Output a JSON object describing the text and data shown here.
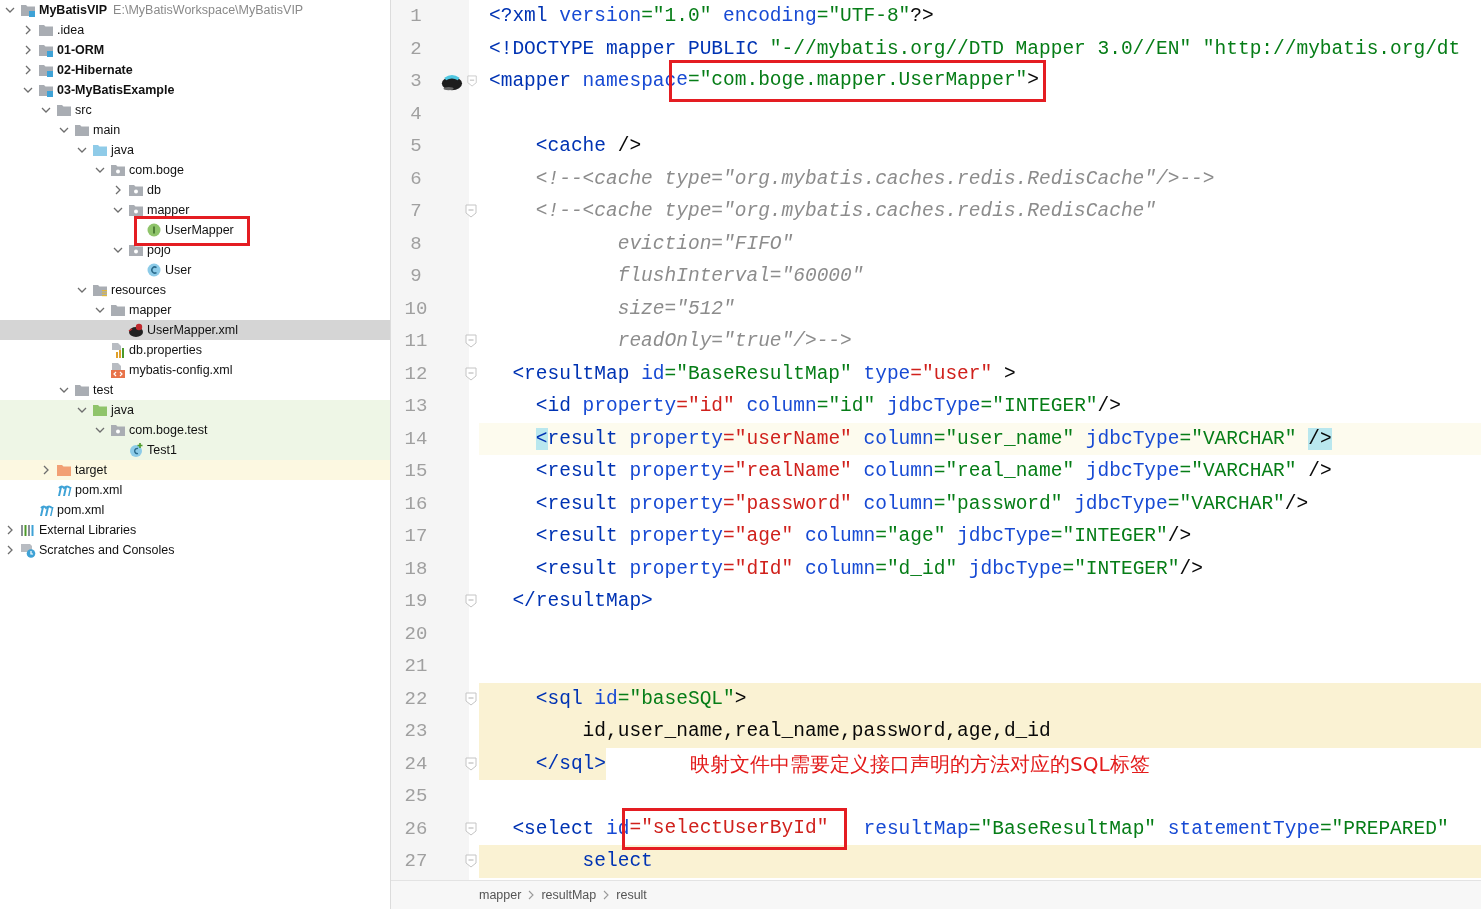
{
  "tree": [
    {
      "label": "MyBatisVIP",
      "path": "E:\\MyBatisWorkspace\\MyBatisVIP",
      "kind": "module",
      "bold": true,
      "expanded": true,
      "selected": false,
      "children": [
        {
          "label": ".idea",
          "kind": "folder",
          "expanded": false,
          "selected": false
        },
        {
          "label": "01-ORM",
          "kind": "module",
          "bold": true,
          "expanded": false,
          "selected": false
        },
        {
          "label": "02-Hibernate",
          "kind": "module",
          "bold": true,
          "expanded": false,
          "selected": false
        },
        {
          "label": "03-MyBatisExample",
          "kind": "module",
          "bold": true,
          "expanded": true,
          "selected": false,
          "children": [
            {
              "label": "src",
              "kind": "folder",
              "expanded": true,
              "selected": false,
              "children": [
                {
                  "label": "main",
                  "kind": "folder",
                  "expanded": true,
                  "selected": false,
                  "children": [
                    {
                      "label": "java",
                      "kind": "source",
                      "expanded": true,
                      "selected": false,
                      "children": [
                        {
                          "label": "com.boge",
                          "kind": "package",
                          "expanded": true,
                          "selected": false,
                          "children": [
                            {
                              "label": "db",
                              "kind": "package",
                              "expanded": false,
                              "selected": false
                            },
                            {
                              "label": "mapper",
                              "kind": "package",
                              "expanded": true,
                              "selected": false,
                              "children": [
                                {
                                  "label": "UserMapper",
                                  "kind": "interface",
                                  "selected": false,
                                  "boxed": true
                                }
                              ]
                            },
                            {
                              "label": "pojo",
                              "kind": "package",
                              "expanded": true,
                              "selected": false,
                              "children": [
                                {
                                  "label": "User",
                                  "kind": "class",
                                  "selected": false
                                }
                              ]
                            }
                          ]
                        }
                      ]
                    },
                    {
                      "label": "resources",
                      "kind": "resources",
                      "expanded": true,
                      "selected": false,
                      "children": [
                        {
                          "label": "mapper",
                          "kind": "folder",
                          "expanded": true,
                          "selected": false,
                          "children": [
                            {
                              "label": "UserMapper.xml",
                              "kind": "mybatis",
                              "selected": true
                            }
                          ]
                        },
                        {
                          "label": "db.properties",
                          "kind": "properties",
                          "selected": false
                        },
                        {
                          "label": "mybatis-config.xml",
                          "kind": "xml",
                          "selected": false
                        }
                      ]
                    }
                  ]
                },
                {
                  "label": "test",
                  "kind": "folder",
                  "expanded": true,
                  "selected": false,
                  "children": [
                    {
                      "label": "java",
                      "kind": "test",
                      "test_scope": true,
                      "expanded": true,
                      "selected": false,
                      "children": [
                        {
                          "label": "com.boge.test",
                          "kind": "package",
                          "test_scope": true,
                          "expanded": true,
                          "selected": false,
                          "children": [
                            {
                              "label": "Test1",
                              "kind": "testclass",
                              "test_scope": true,
                              "selected": false
                            }
                          ]
                        }
                      ]
                    }
                  ]
                }
              ]
            },
            {
              "label": "target",
              "kind": "excluded",
              "excluded": true,
              "expanded": false,
              "selected": false
            },
            {
              "label": "pom.xml",
              "kind": "maven",
              "selected": false
            }
          ]
        },
        {
          "label": "pom.xml",
          "kind": "maven",
          "selected": false
        }
      ]
    },
    {
      "label": "External Libraries",
      "kind": "libraries",
      "expanded": false,
      "selected": false
    },
    {
      "label": "Scratches and Consoles",
      "kind": "scratches",
      "expanded": false,
      "selected": false
    }
  ],
  "editor": {
    "lines": [
      {
        "number": "1",
        "tokens": [
          {
            "kind": "tag",
            "text": "<?xml"
          },
          {
            "kind": "attr",
            "text": " version"
          },
          {
            "kind": "str",
            "text": "=\"1.0\""
          },
          {
            "kind": "attr",
            "text": " encoding"
          },
          {
            "kind": "str",
            "text": "=\"UTF-8\""
          },
          {
            "kind": "plain",
            "text": "?>"
          }
        ]
      },
      {
        "number": "2",
        "tokens": [
          {
            "kind": "tag",
            "text": "<!DOCTYPE mapper PUBLIC"
          },
          {
            "kind": "str",
            "text": " \"-//mybatis.org//DTD Mapper 3.0//EN\" \"http://mybatis.org/dt"
          }
        ]
      },
      {
        "number": "3",
        "gutter_icon": true,
        "fold": true,
        "tokens": [
          {
            "kind": "tag",
            "text": "<mapper"
          },
          {
            "kind": "attr",
            "text": " namespac"
          },
          {
            "kind": "box",
            "tokens": [
              {
                "kind": "attr",
                "text": "e"
              },
              {
                "kind": "str",
                "text": "=\"com.boge.mapper.UserMapper\""
              },
              {
                "kind": "plain",
                "text": ">"
              }
            ]
          }
        ]
      },
      {
        "number": "4"
      },
      {
        "number": "5",
        "tokens": [
          {
            "kind": "tag",
            "text": "    <cache"
          },
          {
            "kind": "plain",
            "text": " />"
          }
        ]
      },
      {
        "number": "6",
        "tokens": [
          {
            "kind": "comment",
            "text": "    <!--<cache type=\"org.mybatis.caches.redis.RedisCache\"/>-->"
          }
        ]
      },
      {
        "number": "7",
        "fold": true,
        "tokens": [
          {
            "kind": "comment",
            "text": "    <!--<cache type=\"org.mybatis.caches.redis.RedisCache\""
          }
        ]
      },
      {
        "number": "8",
        "tokens": [
          {
            "kind": "comment",
            "text": "           eviction=\"FIFO\""
          }
        ]
      },
      {
        "number": "9",
        "tokens": [
          {
            "kind": "comment",
            "text": "           flushInterval=\"60000\""
          }
        ]
      },
      {
        "number": "10",
        "tokens": [
          {
            "kind": "comment",
            "text": "           size=\"512\""
          }
        ]
      },
      {
        "number": "11",
        "fold": true,
        "tokens": [
          {
            "kind": "comment",
            "text": "           readOnly=\"true\"/>-->"
          }
        ]
      },
      {
        "number": "12",
        "fold": true,
        "tokens": [
          {
            "kind": "tag",
            "text": "  <resultMap"
          },
          {
            "kind": "attr",
            "text": " id"
          },
          {
            "kind": "str",
            "text": "=\"BaseResultMap\""
          },
          {
            "kind": "attr",
            "text": " type"
          },
          {
            "kind": "red",
            "text": "=\"user\""
          },
          {
            "kind": "plain",
            "text": " >"
          }
        ]
      },
      {
        "number": "13",
        "tokens": [
          {
            "kind": "tag",
            "text": "    <id"
          },
          {
            "kind": "attr",
            "text": " property"
          },
          {
            "kind": "red",
            "text": "=\"id\""
          },
          {
            "kind": "attr",
            "text": " column"
          },
          {
            "kind": "str",
            "text": "=\"id\""
          },
          {
            "kind": "attr",
            "text": " jdbcType"
          },
          {
            "kind": "str",
            "text": "=\"INTEGER\""
          },
          {
            "kind": "plain",
            "text": "/>"
          }
        ]
      },
      {
        "number": "14",
        "current": true,
        "tokens": [
          {
            "kind": "tag",
            "text": "    <",
            "match": true
          },
          {
            "kind": "tag",
            "text": "result"
          },
          {
            "kind": "attr",
            "text": " property"
          },
          {
            "kind": "red",
            "text": "=\"userName\""
          },
          {
            "kind": "attr",
            "text": " column"
          },
          {
            "kind": "str",
            "text": "=\"user_name\""
          },
          {
            "kind": "attr",
            "text": " jdbcType"
          },
          {
            "kind": "str",
            "text": "=\"VARCHAR\" "
          },
          {
            "kind": "plain",
            "text": "/>",
            "match": true
          }
        ]
      },
      {
        "number": "15",
        "tokens": [
          {
            "kind": "tag",
            "text": "    <result"
          },
          {
            "kind": "attr",
            "text": " property"
          },
          {
            "kind": "red",
            "text": "=\"realName\""
          },
          {
            "kind": "attr",
            "text": " column"
          },
          {
            "kind": "str",
            "text": "=\"real_name\""
          },
          {
            "kind": "attr",
            "text": " jdbcType"
          },
          {
            "kind": "str",
            "text": "=\"VARCHAR\""
          },
          {
            "kind": "plain",
            "text": " />"
          }
        ]
      },
      {
        "number": "16",
        "tokens": [
          {
            "kind": "tag",
            "text": "    <result"
          },
          {
            "kind": "attr",
            "text": " property"
          },
          {
            "kind": "red",
            "text": "=\"password\""
          },
          {
            "kind": "attr",
            "text": " column"
          },
          {
            "kind": "str",
            "text": "=\"password\""
          },
          {
            "kind": "attr",
            "text": " jdbcType"
          },
          {
            "kind": "str",
            "text": "=\"VARCHAR\""
          },
          {
            "kind": "plain",
            "text": "/>"
          }
        ]
      },
      {
        "number": "17",
        "tokens": [
          {
            "kind": "tag",
            "text": "    <result"
          },
          {
            "kind": "attr",
            "text": " property"
          },
          {
            "kind": "red",
            "text": "=\"age\""
          },
          {
            "kind": "attr",
            "text": " column"
          },
          {
            "kind": "str",
            "text": "=\"age\""
          },
          {
            "kind": "attr",
            "text": " jdbcType"
          },
          {
            "kind": "str",
            "text": "=\"INTEGER\""
          },
          {
            "kind": "plain",
            "text": "/>"
          }
        ]
      },
      {
        "number": "18",
        "tokens": [
          {
            "kind": "tag",
            "text": "    <result"
          },
          {
            "kind": "attr",
            "text": " property"
          },
          {
            "kind": "red",
            "text": "=\"dId\""
          },
          {
            "kind": "attr",
            "text": " column"
          },
          {
            "kind": "str",
            "text": "=\"d_id\""
          },
          {
            "kind": "attr",
            "text": " jdbcType"
          },
          {
            "kind": "str",
            "text": "=\"INTEGER\""
          },
          {
            "kind": "plain",
            "text": "/>"
          }
        ]
      },
      {
        "number": "19",
        "fold": true,
        "tokens": [
          {
            "kind": "tag",
            "text": "  </resultMap>"
          }
        ]
      },
      {
        "number": "20"
      },
      {
        "number": "21"
      },
      {
        "number": "22",
        "fold": true,
        "injected": true,
        "tokens": [
          {
            "kind": "tag",
            "text": "    <sql"
          },
          {
            "kind": "attr",
            "text": " id"
          },
          {
            "kind": "str",
            "text": "=\"baseSQL\""
          },
          {
            "kind": "plain",
            "text": ">"
          }
        ]
      },
      {
        "number": "23",
        "injected": true,
        "tokens": [
          {
            "kind": "plain",
            "text": "        id,user_name,real_name,password,age,d_id"
          }
        ]
      },
      {
        "number": "24",
        "fold": true,
        "injected": true,
        "annotation": "映射文件中需要定义接口声明的方法对应的SQL标签",
        "tokens": [
          {
            "kind": "tag",
            "text": "    </sql>"
          }
        ]
      },
      {
        "number": "25"
      },
      {
        "number": "26",
        "fold": true,
        "tokens": [
          {
            "kind": "tag",
            "text": "  <select"
          },
          {
            "kind": "attr",
            "text": " id"
          },
          {
            "kind": "box",
            "tokens": [
              {
                "kind": "red",
                "text": "=\"selectUserById\" "
              }
            ]
          },
          {
            "kind": "attr",
            "text": "  resultMap"
          },
          {
            "kind": "str",
            "text": "=\"BaseResultMap\""
          },
          {
            "kind": "attr",
            "text": " statementType"
          },
          {
            "kind": "str",
            "text": "=\"PREPARED\""
          }
        ]
      },
      {
        "number": "27",
        "fold": true,
        "injected": true,
        "tokens": [
          {
            "kind": "tag",
            "text": "        select"
          }
        ]
      }
    ]
  },
  "breadcrumbs": [
    "mapper",
    "resultMap",
    "result"
  ]
}
